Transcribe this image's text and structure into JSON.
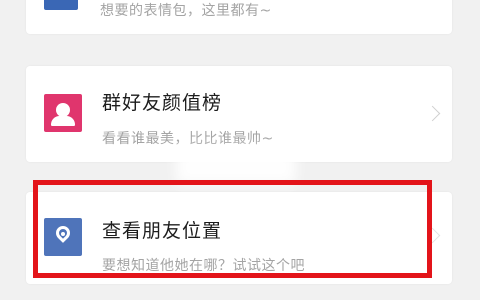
{
  "cards": [
    {
      "title": "",
      "subtitle": "想要的表情包，这里都有~",
      "icon": "emoji-pack-icon"
    },
    {
      "title": "群好友颜值榜",
      "subtitle": "看看谁最美，比比谁最帅~",
      "icon": "person-icon",
      "icon_color": "#e0356d"
    },
    {
      "title": "查看朋友位置",
      "subtitle": "要想知道他她在哪？试试这个吧",
      "icon": "location-pin-icon",
      "icon_color": "#4f74ba"
    }
  ],
  "highlight_color": "#e3141a"
}
